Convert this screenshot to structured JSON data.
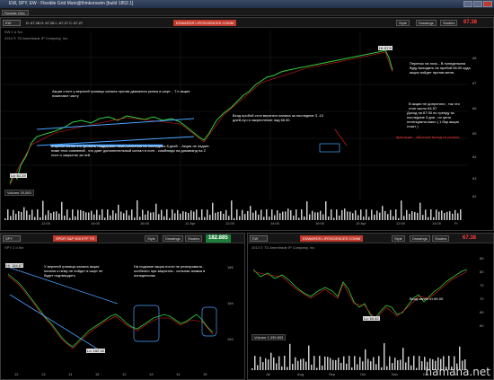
{
  "window": {
    "title": "EW, SPY, EW - Flexible Grid Main@thinkorswim [build 1852.1]"
  },
  "toolbar": {
    "grid_label": "Flexible Grid"
  },
  "main_chart": {
    "symbol": "EW",
    "ticker": "EDWARDS LIFESCIENCES COMM",
    "quote": "D: 67.28  H: 67.28  L: 67.27  C: 67.27",
    "style_btn": "Style",
    "drawings_btn": "Drawings",
    "studies_btn": "Studies",
    "price": "67.38",
    "subtitle": "EW 2 d 3m",
    "subtitle2": "2013 © TD Ameritrade IP Company, Inc.",
    "lo_label": "Lo: 61.19",
    "hi_label": "Hi: 67.5",
    "volume_label": "Volume",
    "volume_value": "20,083",
    "annotations": {
      "a1": "Акция стоит у верхней границы канала против движения рынка в шорт .. Т.е акции пожелают часту",
      "a2": "Жирная линия это уровень поддержки ниже,сомнения на последних 8 дней .. Акция не падает ниже этих сомнений , что дает дополнительный сигнал в лонг - сомблюди на доминанд на Z лист и закрытие за ней",
      "a3": "Вход пробой стоп верхнего канала за последние 3 -10 дней,луч и закрепление над 66.50",
      "a4": "Перенос на ночь - В понедельник буду выходить на пробой 66.00 куда акция пойдет против меня.",
      "a5": "В акции не допустили , так что стоп около 64.57",
      "a6": "Доход на 67.00 по тренду за последние 3 дня , но цели потенциала мало ( 1 бар акция стоит )",
      "a7": "фиксация - обычный выход из канала"
    },
    "right_axis": [
      "68",
      "67",
      "66",
      "65",
      "64",
      "63",
      "62"
    ],
    "time_axis": [
      "12:00",
      "14:00",
      "16:00",
      "12 Apr",
      "12:00",
      "14:00",
      "16:00",
      "15 Apr",
      "12:00",
      "14:00",
      "Fr"
    ]
  },
  "spy_chart": {
    "symbol": "SPY",
    "ticker": "SPDR S&P 500 ETF TR",
    "quote": "D: 03.01.14  O: 182.86  H: 182.86  L: 182.84  C: 182.86",
    "style_btn": "Style",
    "drawings_btn": "Drawings",
    "studies_btn": "Studies",
    "price": "182.885",
    "subtitle": "SPY 2 d 5m",
    "hi_label": "Hi: 184.67",
    "lo_label": "Lo: 182.46",
    "annotations": {
      "a1": "У верхней границы канала акция попали к нему не пойдет в шорт не будет подтвердить",
      "a2": "На подьеме акция почти не реагировала , особенно при закрытии - сильная заявка в понедельник"
    },
    "right_axis": [
      "185",
      "184",
      "183"
    ],
    "time_axis": [
      "12",
      "13",
      "14",
      "15",
      "12",
      "13",
      "14",
      "15"
    ]
  },
  "ew_daily": {
    "symbol": "EW",
    "ticker": "EDWARDS LIFESCIENCES COMM",
    "quote": "D: 03.01.14  O: 67.28  H: 67.30  L: 66.17  C: 67.27",
    "style_btn": "Style",
    "drawings_btn": "Drawings",
    "studies_btn": "Studies",
    "price": "67.38",
    "subtitle": "2013 © TD Ameritrade IP Company, Inc.",
    "lo_label": "Lo: 60.82",
    "note": "Вход канал от 65.00",
    "volume_label": "Volume",
    "volume_value": "1,339,893",
    "right_axis": [
      "85",
      "80",
      "75",
      "70",
      "65",
      "60"
    ],
    "time_axis": [
      "Jul",
      "Aug",
      "Sep",
      "Oct",
      "Nov",
      "Dec",
      "14"
    ]
  },
  "watermark": "hamaha.net",
  "colors": {
    "accent_red": "#ff3b3b",
    "up": "#2fcf3a",
    "down": "#e02020",
    "channel": "#4aa3ff"
  }
}
